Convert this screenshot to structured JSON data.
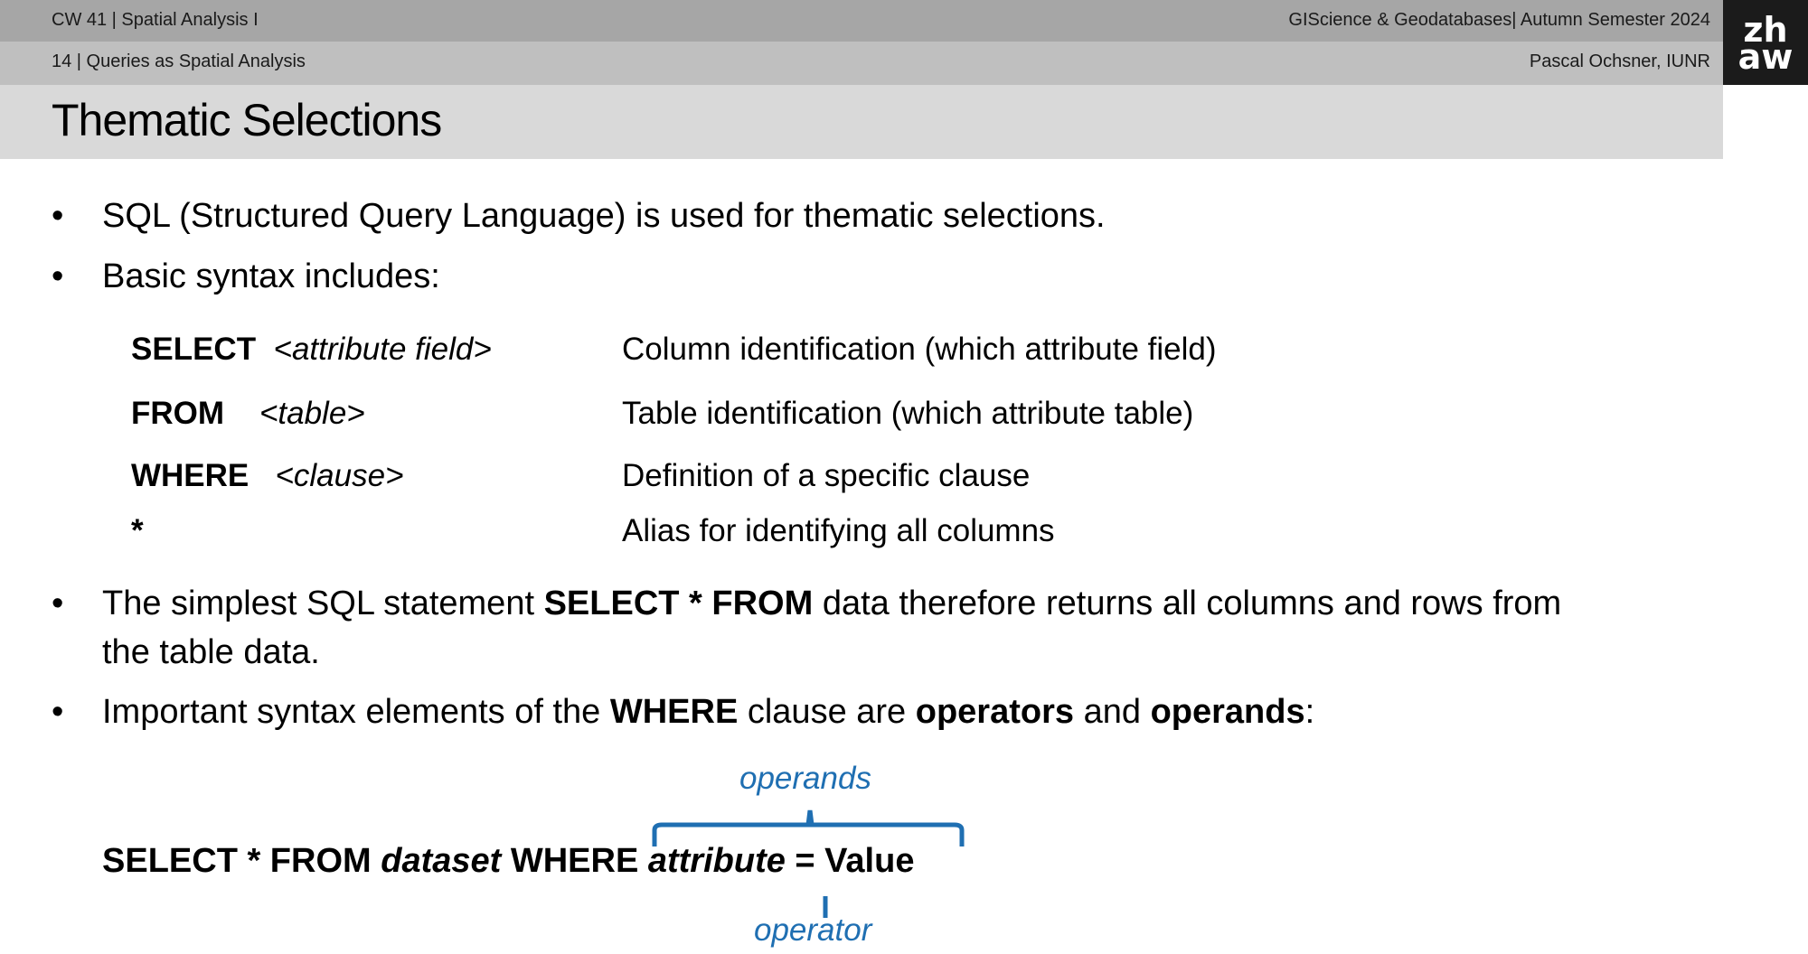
{
  "header": {
    "course": "CW 41 | Spatial Analysis I",
    "subject": "GIScience & Geodatabases| Autumn Semester 2024",
    "slide": "14 | Queries as Spatial Analysis",
    "author": "Pascal Ochsner, IUNR",
    "logo_top": "zh",
    "logo_bottom": "aw"
  },
  "title": "Thematic Selections",
  "bullets": {
    "b1": "SQL (Structured Query Language) is used for thematic selections.",
    "b2": "Basic syntax includes:",
    "b3_pre": "The simplest SQL statement ",
    "b3_bold": "SELECT * FROM",
    "b3_post": " data therefore returns all columns and rows from",
    "b3_line2": "the table data.",
    "b4_pre": "Important syntax elements of the ",
    "b4_where": "WHERE",
    "b4_mid1": " clause are ",
    "b4_operators": "operators",
    "b4_mid2": " and ",
    "b4_operands": "operands",
    "b4_post": ":"
  },
  "syntax": [
    {
      "keyword": "SELECT",
      "arg": "<attribute field>",
      "desc": "Column identification (which attribute field)"
    },
    {
      "keyword": "FROM",
      "arg": "<table>",
      "desc": "Table identification (which attribute table)"
    },
    {
      "keyword": "WHERE",
      "arg": "<clause>",
      "desc": "Definition of a specific clause"
    },
    {
      "keyword": "*",
      "arg": "",
      "desc": "Alias for identifying all columns"
    }
  ],
  "example": {
    "part1": "SELECT * FROM ",
    "dataset": "dataset",
    "part2": " WHERE ",
    "attribute": "attribute",
    "part3": " = Value",
    "operands_label": "operands",
    "operator_label": "operator",
    "accent_color": "#1f6fb2"
  }
}
